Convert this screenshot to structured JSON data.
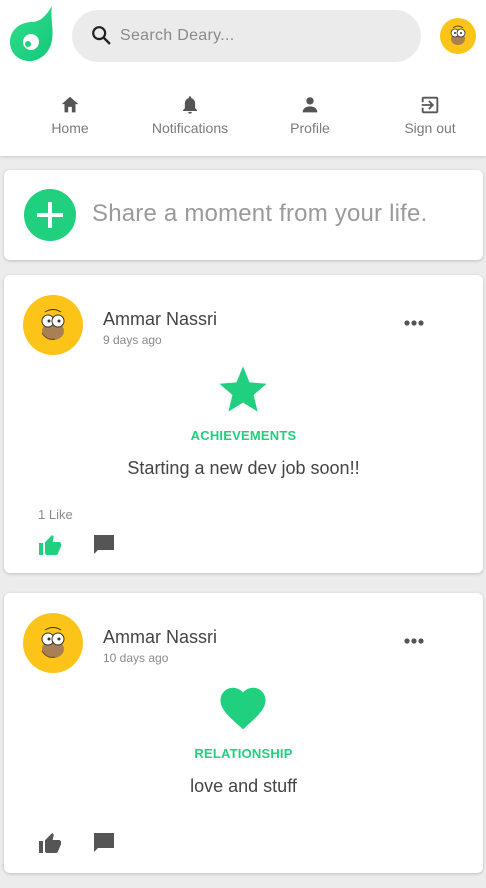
{
  "search": {
    "placeholder": "Search Deary..."
  },
  "nav": [
    {
      "label": "Home",
      "icon": "home-icon"
    },
    {
      "label": "Notifications",
      "icon": "bell-icon"
    },
    {
      "label": "Profile",
      "icon": "person-icon"
    },
    {
      "label": "Sign out",
      "icon": "sign-out-icon"
    }
  ],
  "composer": {
    "prompt": "Share a moment from your life."
  },
  "posts": [
    {
      "author": "Ammar Nassri",
      "time": "9 days ago",
      "category": "ACHIEVEMENTS",
      "category_icon": "star-icon",
      "text": "Starting a new dev job soon!!",
      "likes": "1 Like",
      "liked": true
    },
    {
      "author": "Ammar Nassri",
      "time": "10 days ago",
      "category": "RELATIONSHIP",
      "category_icon": "heart-icon",
      "text": "love and stuff",
      "likes": "",
      "liked": false
    }
  ],
  "colors": {
    "accent": "#20d07f",
    "avatar_bg": "#fcc419",
    "icon_gray": "#555555",
    "page_bg": "#ececec"
  }
}
